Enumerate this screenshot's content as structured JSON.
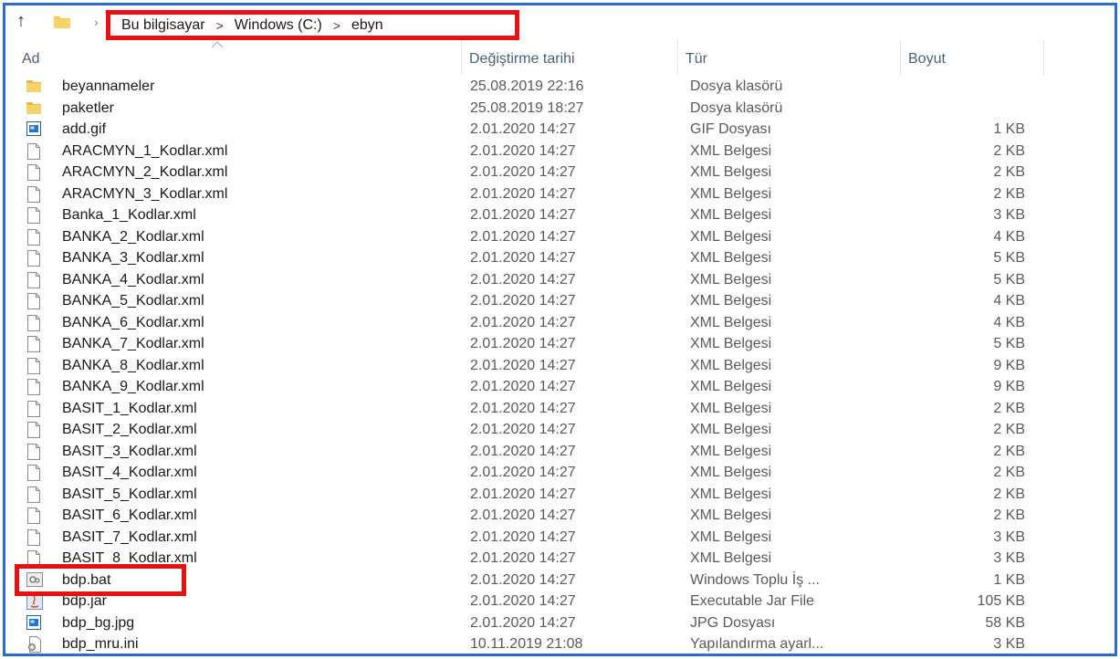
{
  "breadcrumb": [
    "Bu bilgisayar",
    "Windows (C:)",
    "ebyn"
  ],
  "columns": {
    "name": "Ad",
    "date": "Değiştirme tarihi",
    "type": "Tür",
    "size": "Boyut"
  },
  "files": [
    {
      "icon": "folder-icon",
      "name": "beyannameler",
      "date": "25.08.2019 22:16",
      "type": "Dosya klasörü",
      "size": ""
    },
    {
      "icon": "folder-icon",
      "name": "paketler",
      "date": "25.08.2019 18:27",
      "type": "Dosya klasörü",
      "size": ""
    },
    {
      "icon": "image-file-icon",
      "name": "add.gif",
      "date": "2.01.2020 14:27",
      "type": "GIF Dosyası",
      "size": "1 KB"
    },
    {
      "icon": "document-file-icon",
      "name": "ARACMYN_1_Kodlar.xml",
      "date": "2.01.2020 14:27",
      "type": "XML Belgesi",
      "size": "2 KB"
    },
    {
      "icon": "document-file-icon",
      "name": "ARACMYN_2_Kodlar.xml",
      "date": "2.01.2020 14:27",
      "type": "XML Belgesi",
      "size": "2 KB"
    },
    {
      "icon": "document-file-icon",
      "name": "ARACMYN_3_Kodlar.xml",
      "date": "2.01.2020 14:27",
      "type": "XML Belgesi",
      "size": "2 KB"
    },
    {
      "icon": "document-file-icon",
      "name": "Banka_1_Kodlar.xml",
      "date": "2.01.2020 14:27",
      "type": "XML Belgesi",
      "size": "3 KB"
    },
    {
      "icon": "document-file-icon",
      "name": "BANKA_2_Kodlar.xml",
      "date": "2.01.2020 14:27",
      "type": "XML Belgesi",
      "size": "4 KB"
    },
    {
      "icon": "document-file-icon",
      "name": "BANKA_3_Kodlar.xml",
      "date": "2.01.2020 14:27",
      "type": "XML Belgesi",
      "size": "5 KB"
    },
    {
      "icon": "document-file-icon",
      "name": "BANKA_4_Kodlar.xml",
      "date": "2.01.2020 14:27",
      "type": "XML Belgesi",
      "size": "5 KB"
    },
    {
      "icon": "document-file-icon",
      "name": "BANKA_5_Kodlar.xml",
      "date": "2.01.2020 14:27",
      "type": "XML Belgesi",
      "size": "4 KB"
    },
    {
      "icon": "document-file-icon",
      "name": "BANKA_6_Kodlar.xml",
      "date": "2.01.2020 14:27",
      "type": "XML Belgesi",
      "size": "4 KB"
    },
    {
      "icon": "document-file-icon",
      "name": "BANKA_7_Kodlar.xml",
      "date": "2.01.2020 14:27",
      "type": "XML Belgesi",
      "size": "5 KB"
    },
    {
      "icon": "document-file-icon",
      "name": "BANKA_8_Kodlar.xml",
      "date": "2.01.2020 14:27",
      "type": "XML Belgesi",
      "size": "9 KB"
    },
    {
      "icon": "document-file-icon",
      "name": "BANKA_9_Kodlar.xml",
      "date": "2.01.2020 14:27",
      "type": "XML Belgesi",
      "size": "9 KB"
    },
    {
      "icon": "document-file-icon",
      "name": "BASIT_1_Kodlar.xml",
      "date": "2.01.2020 14:27",
      "type": "XML Belgesi",
      "size": "2 KB"
    },
    {
      "icon": "document-file-icon",
      "name": "BASIT_2_Kodlar.xml",
      "date": "2.01.2020 14:27",
      "type": "XML Belgesi",
      "size": "2 KB"
    },
    {
      "icon": "document-file-icon",
      "name": "BASIT_3_Kodlar.xml",
      "date": "2.01.2020 14:27",
      "type": "XML Belgesi",
      "size": "2 KB"
    },
    {
      "icon": "document-file-icon",
      "name": "BASIT_4_Kodlar.xml",
      "date": "2.01.2020 14:27",
      "type": "XML Belgesi",
      "size": "2 KB"
    },
    {
      "icon": "document-file-icon",
      "name": "BASIT_5_Kodlar.xml",
      "date": "2.01.2020 14:27",
      "type": "XML Belgesi",
      "size": "2 KB"
    },
    {
      "icon": "document-file-icon",
      "name": "BASIT_6_Kodlar.xml",
      "date": "2.01.2020 14:27",
      "type": "XML Belgesi",
      "size": "2 KB"
    },
    {
      "icon": "document-file-icon",
      "name": "BASIT_7_Kodlar.xml",
      "date": "2.01.2020 14:27",
      "type": "XML Belgesi",
      "size": "3 KB"
    },
    {
      "icon": "document-file-icon",
      "name": "BASIT_8_Kodlar.xml",
      "date": "2.01.2020 14:27",
      "type": "XML Belgesi",
      "size": "3 KB"
    },
    {
      "icon": "batch-file-icon",
      "name": "bdp.bat",
      "date": "2.01.2020 14:27",
      "type": "Windows Toplu İş ...",
      "size": "1 KB"
    },
    {
      "icon": "java-jar-icon",
      "name": "bdp.jar",
      "date": "2.01.2020 14:27",
      "type": "Executable Jar File",
      "size": "105 KB"
    },
    {
      "icon": "image-file-icon",
      "name": "bdp_bg.jpg",
      "date": "2.01.2020 14:27",
      "type": "JPG Dosyası",
      "size": "58 KB"
    },
    {
      "icon": "settings-file-icon",
      "name": "bdp_mru.ini",
      "date": "10.11.2019 21:08",
      "type": "Yapılandırma ayarl...",
      "size": "3 KB"
    }
  ],
  "colors": {
    "frame_border": "#2a6ec7",
    "highlight": "#e81010",
    "folder": "#f2c94c"
  }
}
